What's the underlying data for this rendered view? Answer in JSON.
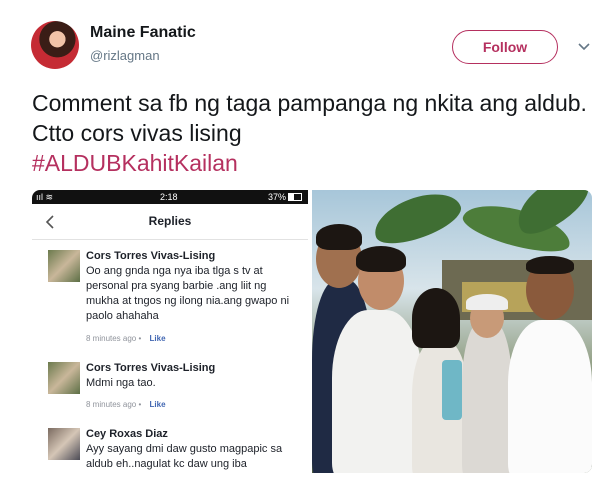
{
  "author": {
    "display_name": "Maine Fanatic",
    "handle": "@rizlagman"
  },
  "follow_label": "Follow",
  "tweet": {
    "text": "Comment sa fb ng taga pampanga ng nkita ang aldub. Ctto cors vivas lising",
    "hashtag": "#ALDUBKahitKailan"
  },
  "screenshot": {
    "status": {
      "signal": "ııl ≋",
      "time": "2:18",
      "battery": "37%"
    },
    "header_title": "Replies",
    "comments": [
      {
        "name": "Cors Torres Vivas-Lising",
        "body": "Oo ang gnda nga nya iba tlga s tv at personal pra syang barbie .ang liit ng mukha at tngos ng ilong nia.ang gwapo ni paolo ahahaha",
        "time": "8 minutes ago",
        "like": "Like"
      },
      {
        "name": "Cors Torres Vivas-Lising",
        "body": "Mdmi nga tao.",
        "time": "8 minutes ago",
        "like": "Like"
      },
      {
        "name": "Cey Roxas Diaz",
        "body": "Ayy sayang dmi daw gusto magpapic sa aldub eh..nagulat kc daw ung iba",
        "time": "",
        "like": ""
      }
    ]
  },
  "colors": {
    "accent": "#b5305f",
    "link": "#4267b2",
    "text": "#14171a",
    "muted": "#657786"
  }
}
